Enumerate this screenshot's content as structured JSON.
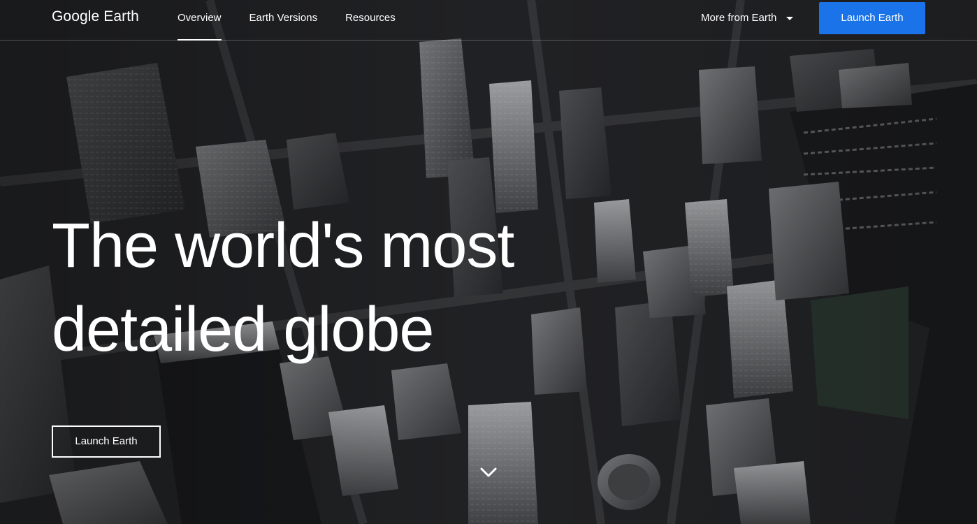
{
  "header": {
    "logo": "Google Earth",
    "nav": [
      {
        "label": "Overview",
        "active": true
      },
      {
        "label": "Earth Versions",
        "active": false
      },
      {
        "label": "Resources",
        "active": false
      }
    ],
    "more_label": "More from Earth",
    "launch_label": "Launch Earth"
  },
  "hero": {
    "headline_line1": "The world's most",
    "headline_line2": "detailed globe",
    "cta_label": "Launch Earth",
    "scroll_icon": "chevron-down-icon"
  },
  "colors": {
    "accent": "#1a73e8",
    "text": "#ffffff",
    "background": "#1a1b1e"
  }
}
